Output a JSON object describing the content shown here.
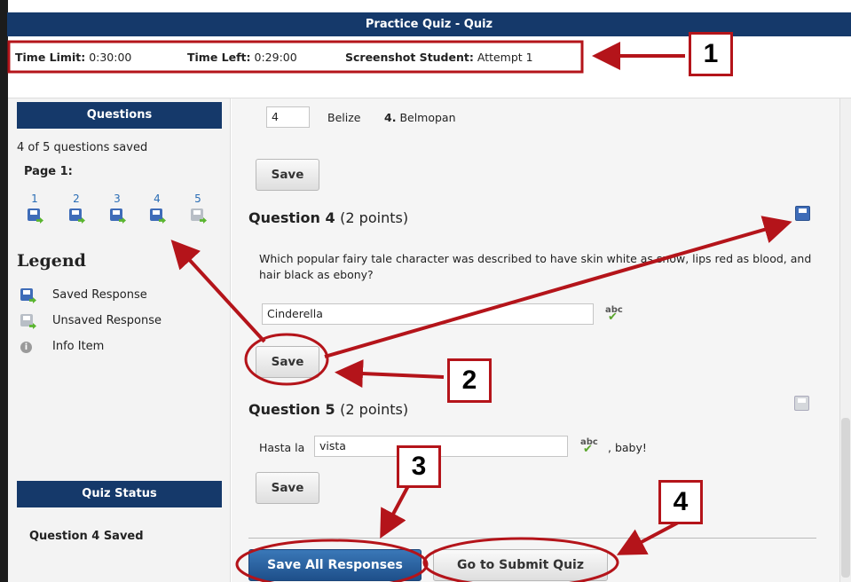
{
  "header": {
    "title": "Practice Quiz - Quiz",
    "time_limit_label": "Time Limit:",
    "time_limit_value": "0:30:00",
    "time_left_label": "Time Left:",
    "time_left_value": "0:29:00",
    "student_label": "Screenshot Student:",
    "attempt": "Attempt 1"
  },
  "sidebar": {
    "questions_header": "Questions",
    "saved_count": "4 of 5 questions saved",
    "page_label": "Page 1:",
    "question_nav": [
      {
        "num": "1",
        "icon": "saved-disk-icon"
      },
      {
        "num": "2",
        "icon": "saved-disk-icon"
      },
      {
        "num": "3",
        "icon": "saved-disk-icon"
      },
      {
        "num": "4",
        "icon": "saved-disk-icon"
      },
      {
        "num": "5",
        "icon": "unsaved-disk-icon"
      }
    ],
    "legend_title": "Legend",
    "legend": [
      {
        "label": "Saved Response",
        "icon": "saved-disk-icon"
      },
      {
        "label": "Unsaved Response",
        "icon": "unsaved-disk-icon"
      },
      {
        "label": "Info Item",
        "icon": "info-icon"
      }
    ],
    "status_header": "Quiz Status",
    "status_text": "Question 4 Saved"
  },
  "main": {
    "q3": {
      "answer_value": "4",
      "country": "Belize",
      "option_num": "4.",
      "option_text": "Belmopan",
      "save_label": "Save"
    },
    "q4": {
      "title": "Question 4",
      "points": "(2 points)",
      "text": "Which popular fairy tale character was described to have skin white as snow, lips red as blood, and hair black as ebony?",
      "answer": "Cinderella",
      "save_label": "Save"
    },
    "q5": {
      "title": "Question 5",
      "points": "(2 points)",
      "prefix": "Hasta la",
      "answer": "vista",
      "suffix": ", baby!",
      "save_label": "Save"
    },
    "spell_label": "abc",
    "save_all_label": "Save All Responses",
    "submit_label": "Go to Submit Quiz"
  },
  "callouts": [
    "1",
    "2",
    "3",
    "4"
  ],
  "colors": {
    "header_navy": "#15396a",
    "annotation_red": "#b4141a",
    "saved_blue": "#3e6cb8",
    "check_green": "#5aa52c"
  }
}
